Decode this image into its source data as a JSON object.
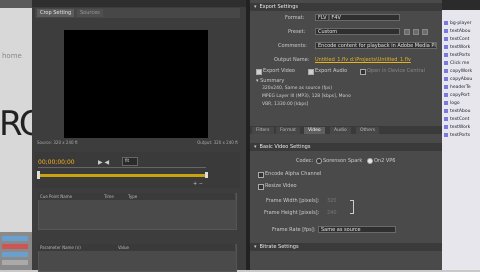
{
  "left_tabs": [
    "Crop Setting",
    "Sources"
  ],
  "left_status": {
    "source": "Source: 320 x 240 ft",
    "output": "Output: 320 x 240 ft"
  },
  "timecode": "00;00;00;00",
  "fit_value": "fit",
  "cue_headers": [
    "Cue Point Name",
    "Time",
    "Type"
  ],
  "param_headers": [
    "Parameter Name (n)",
    "Value"
  ],
  "background": {
    "word1": "home",
    "word2": "RC"
  },
  "export_settings": {
    "header": "Export Settings",
    "format_label": "Format:",
    "format_value": "FLV | F4V",
    "preset_label": "Preset:",
    "preset_value": "Custom",
    "comments_label": "Comments:",
    "comments_value": "Encode content for playback in Adobe Media Pl",
    "output_label": "Output Name:",
    "output_value": "Untitled_1.flv  d:\\Projects\\Untitled_1.flv",
    "export_video": "Export Video",
    "export_audio": "Export Audio",
    "open_central": "Open in Device Central",
    "summary_label": "Summary",
    "summary_lines": [
      "320x240, Same as source (fps)",
      "MPEG Layer III (MP3), 128 [kbps], Mono",
      "VBR, 1330.00 [kbps]"
    ]
  },
  "right_tabs": [
    "Filters",
    "Format",
    "Video",
    "Audio",
    "Others"
  ],
  "right_tab_active": 2,
  "basic_video": {
    "header": "Basic Video Settings",
    "codec_label": "Codec:",
    "codec_options": [
      "Sorenson Spark",
      "On2 VP6"
    ],
    "codec_selected": 1,
    "encode_alpha": "Encode Alpha Channel",
    "resize_video": "Resize Video",
    "frame_width_label": "Frame Width [pixels]:",
    "frame_width_value": "320",
    "frame_height_label": "Frame Height [pixels]:",
    "frame_height_value": "240",
    "frame_rate_label": "Frame Rate [fps]:",
    "frame_rate_value": "Same as source"
  },
  "bitrate": {
    "header": "Bitrate Settings"
  },
  "right_strip_items": [
    "bg-player",
    "textAbou",
    "textCont",
    "textWork",
    "textPorts",
    "Click me",
    "copyWork",
    "copyAbou",
    "headerTe",
    "copyPort",
    "logo",
    "textAbou",
    "textCont",
    "textWork",
    "textPorts"
  ]
}
